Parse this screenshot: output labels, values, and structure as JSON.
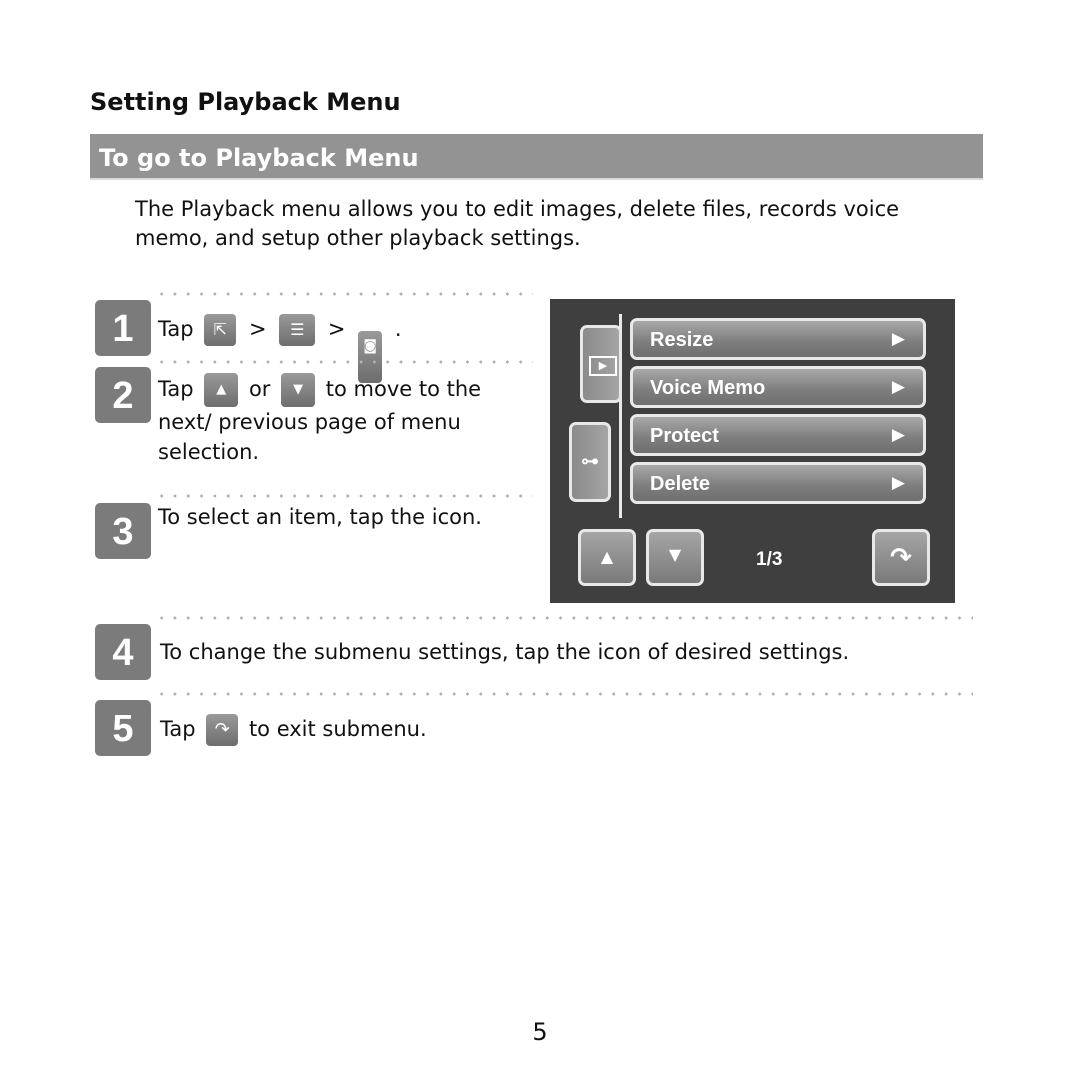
{
  "section_title": "Setting Playback Menu",
  "subsection_title": "To go to Playback Menu",
  "intro": "The Playback menu allows you to edit images, delete files, records voice memo, and setup other playback settings.",
  "steps": [
    {
      "number": "1",
      "prefix": "Tap",
      "sep1": ">",
      "sep2": ">",
      "suffix": ".",
      "icons": [
        "resize-mode-icon",
        "menu-icon",
        "camera-tab-icon"
      ]
    },
    {
      "number": "2",
      "prefix": "Tap",
      "middle": "or",
      "line1_suffix": "to move to the",
      "line2": "next/ previous page of menu",
      "line3": "selection.",
      "icons": [
        "up-arrow-icon",
        "down-arrow-icon"
      ]
    },
    {
      "number": "3",
      "text": "To select an item, tap the icon."
    },
    {
      "number": "4",
      "text": "To change the submenu settings, tap the icon of desired settings."
    },
    {
      "number": "5",
      "prefix": "Tap",
      "suffix": "to exit submenu.",
      "icons": [
        "exit-icon"
      ]
    }
  ],
  "screen": {
    "tabs": [
      {
        "name": "playback-tab",
        "glyph": "▶"
      },
      {
        "name": "settings-tab",
        "glyph": "⊶"
      }
    ],
    "menu_items": [
      {
        "label": "Resize",
        "arrow": "▶"
      },
      {
        "label": "Voice Memo",
        "arrow": "▶"
      },
      {
        "label": "Protect",
        "arrow": "▶"
      },
      {
        "label": "Delete",
        "arrow": "▶"
      }
    ],
    "up_glyph": "▲",
    "down_glyph": "▼",
    "page_indicator": "1/3",
    "exit_glyph": "↷"
  },
  "page_number": "5"
}
